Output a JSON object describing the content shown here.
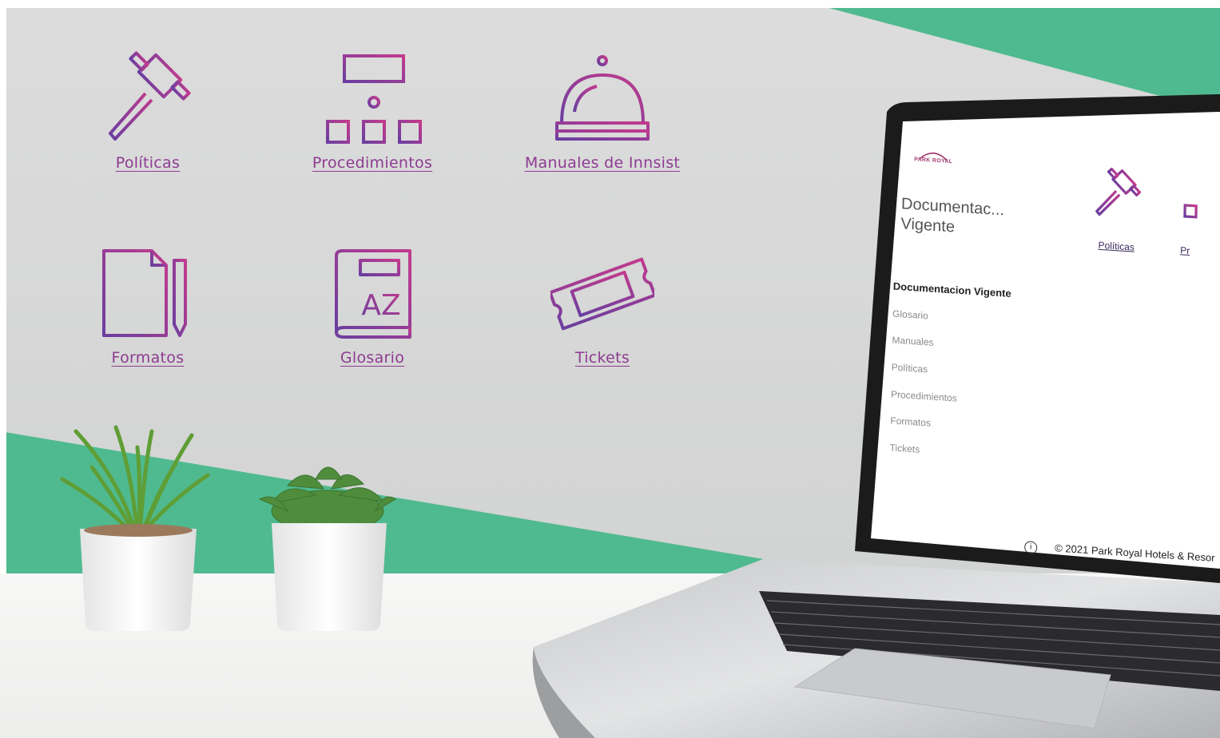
{
  "tiles": [
    {
      "label": "Políticas",
      "icon": "gavel-icon"
    },
    {
      "label": "Procedimientos",
      "icon": "org-chart-icon"
    },
    {
      "label": "Manuales de Innsist",
      "icon": "service-bell-icon"
    },
    {
      "label": "Formatos",
      "icon": "document-pen-icon"
    },
    {
      "label": "Glosario",
      "icon": "glossary-book-icon"
    },
    {
      "label": "Tickets",
      "icon": "ticket-icon"
    }
  ],
  "laptop": {
    "logo_text": "PARK ROYAL",
    "title": "Documentac... Vigente",
    "nav": [
      "Documentacion Vigente",
      "Glosario",
      "Manuales",
      "Políticas",
      "Procedimientos",
      "Formatos",
      "Tickets"
    ],
    "tiles": [
      {
        "label": "Políticas",
        "icon": "gavel-icon"
      },
      {
        "label": "Pr",
        "icon": "org-chart-icon"
      }
    ],
    "footer_icon": "info-icon",
    "footer_text": "© 2021 Park Royal Hotels & Resor"
  },
  "colors": {
    "icon_gradient_start": "#6a3ea0",
    "icon_gradient_end": "#c23b8d",
    "link_color": "#8e3b92",
    "wall": "#d6d7d7",
    "accent_green": "#4fba8f",
    "desk": "#f5f5f4"
  }
}
